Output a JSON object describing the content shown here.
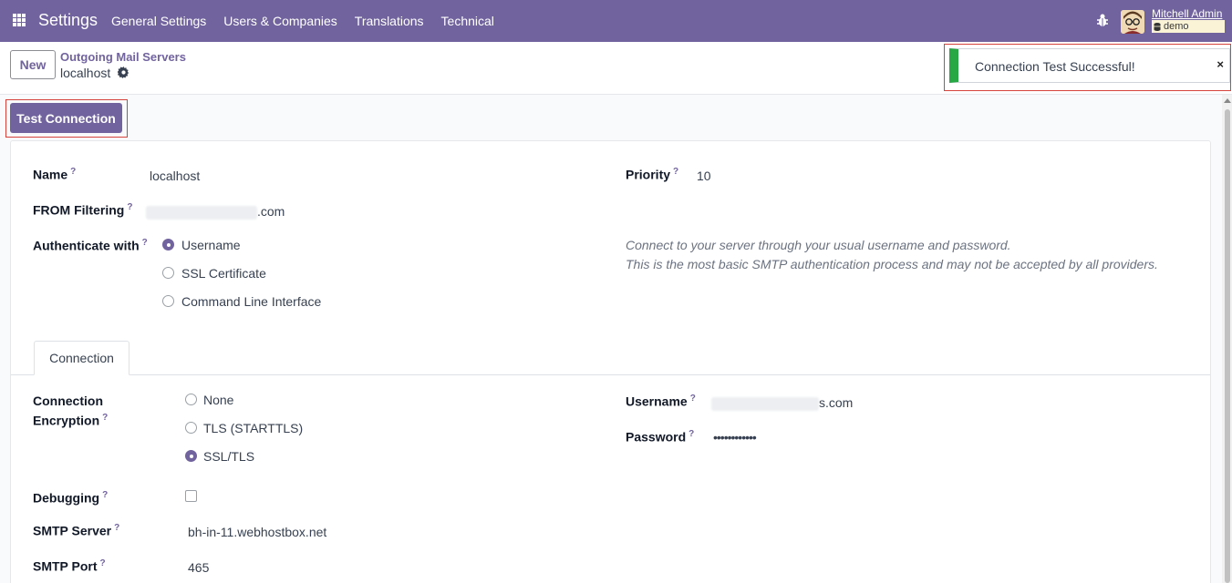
{
  "navbar": {
    "brand": "Settings",
    "menu": [
      "General Settings",
      "Users & Companies",
      "Translations",
      "Technical"
    ],
    "user_name": "Mitchell Admin",
    "db_name": "demo"
  },
  "control_panel": {
    "new_label": "New",
    "breadcrumb": "Outgoing Mail Servers",
    "record_name": "localhost"
  },
  "toast": {
    "message": "Connection Test Successful!",
    "close": "×"
  },
  "actions": {
    "test_connection": "Test Connection"
  },
  "form": {
    "name_label": "Name",
    "name_value": "localhost",
    "priority_label": "Priority",
    "priority_value": "10",
    "from_filter_label": "FROM Filtering",
    "from_filter_suffix": ".com",
    "auth_label": "Authenticate with",
    "auth_options": [
      "Username",
      "SSL Certificate",
      "Command Line Interface"
    ],
    "auth_selected": "Username",
    "auth_desc_1": "Connect to your server through your usual username and password.",
    "auth_desc_2": "This is the most basic SMTP authentication process and may not be accepted by all providers.",
    "tab_connection": "Connection",
    "encryption_label_1": "Connection",
    "encryption_label_2": "Encryption",
    "encryption_options": [
      "None",
      "TLS (STARTTLS)",
      "SSL/TLS"
    ],
    "encryption_selected": "SSL/TLS",
    "username_label": "Username",
    "username_suffix": "s.com",
    "password_label": "Password",
    "password_value": "••••••••••••",
    "debugging_label": "Debugging",
    "smtp_server_label": "SMTP Server",
    "smtp_server_value": "bh-in-11.webhostbox.net",
    "smtp_port_label": "SMTP Port",
    "smtp_port_value": "465",
    "help_mark": "?"
  },
  "colors": {
    "brand": "#71639e",
    "success": "#28a745",
    "highlight": "#d6423c"
  }
}
